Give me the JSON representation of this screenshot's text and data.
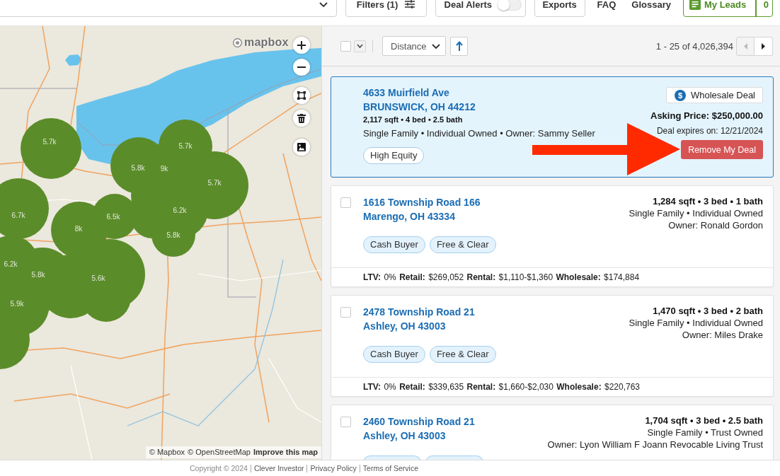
{
  "top_bar": {
    "items": [
      {
        "kind": "dropdown"
      },
      {
        "kind": "filters",
        "label": "Filters (1)"
      },
      {
        "kind": "toggle",
        "label": "Deal Alerts",
        "on": false
      },
      {
        "kind": "button",
        "label": "Exports"
      },
      {
        "kind": "link",
        "label": "FAQ"
      },
      {
        "kind": "link",
        "label": "Glossary"
      },
      {
        "kind": "leads",
        "label": "My Leads",
        "count": "0"
      }
    ]
  },
  "map": {
    "logo": "mapbox",
    "clusters": [
      {
        "label": "5.7k"
      },
      {
        "label": "6.7k"
      },
      {
        "label": "8k"
      },
      {
        "label": "6.5k"
      },
      {
        "label": "5.8k"
      },
      {
        "label": "9k"
      },
      {
        "label": "5.7k"
      },
      {
        "label": "5.7k"
      },
      {
        "label": "6.2k"
      },
      {
        "label": "5.8k"
      },
      {
        "label": "6.2k"
      },
      {
        "label": "5.8k"
      },
      {
        "label": "5.6k"
      },
      {
        "label": "5.9k"
      }
    ],
    "attribution": [
      {
        "kind": "credit",
        "label": "© Mapbox"
      },
      {
        "kind": "credit",
        "label": "© OpenStreetMap"
      },
      {
        "kind": "feedback",
        "label": "Improve this map"
      }
    ]
  },
  "list_toolbar": {
    "select_all": {
      "checked": false
    },
    "sort": {
      "value": "Distance",
      "ascending": true
    },
    "pagination": {
      "range": "1 - 25 of 4,026,394",
      "previous_disabled": true,
      "next_disabled": false
    }
  },
  "listings": [
    {
      "kind": "featured",
      "callout_arrow": true,
      "street": "4633 Muirfield Ave",
      "city": "BRUNSWICK, OH 44212",
      "facts": "2,117 sqft • 4 bed • 2.5 bath",
      "details": [
        "Single Family • Individual Owned • Owner: Sammy Seller"
      ],
      "tags": [
        {
          "kind": "outline",
          "label": "High Equity"
        }
      ],
      "badge": {
        "icon": "$",
        "label": "Wholesale Deal"
      },
      "asking_price": "Asking Price: $250,000.00",
      "expiry": "Deal expires on: 12/21/2024",
      "action": "Remove My Deal"
    },
    {
      "kind": "listing",
      "selected": false,
      "street": "1616 Township Road 166",
      "city": "Marengo, OH 43334",
      "facts": "1,284 sqft • 3 bed • 1 bath",
      "details": [
        "Single Family • Individual Owned",
        "Owner: Ronald Gordon"
      ],
      "tags": [
        {
          "kind": "filled",
          "label": "Cash Buyer"
        },
        {
          "kind": "filled",
          "label": "Free & Clear"
        }
      ],
      "metrics": "**LTV:** 0% **Retail:** $269,052 **Rental:** $1,110-$1,360 **Wholesale:** $174,884"
    },
    {
      "kind": "listing",
      "selected": false,
      "street": "2478 Township Road 21",
      "city": "Ashley, OH 43003",
      "facts": "1,470 sqft • 3 bed • 2 bath",
      "details": [
        "Single Family • Individual Owned",
        "Owner: Miles Drake"
      ],
      "tags": [
        {
          "kind": "filled",
          "label": "Cash Buyer"
        },
        {
          "kind": "filled",
          "label": "Free & Clear"
        }
      ],
      "metrics": "**LTV:** 0% **Retail:** $339,635 **Rental:** $1,660-$2,030 **Wholesale:** $220,763"
    },
    {
      "kind": "listing",
      "selected": false,
      "street": "2460 Township Road 21",
      "city": "Ashley, OH 43003",
      "facts": "1,704 sqft • 3 bed • 2.5 bath",
      "details": [
        "Single Family • Trust Owned",
        "Owner: Lyon William F Joann Revocable Living Trust"
      ],
      "tags": [
        {
          "kind": "cut-off"
        },
        {
          "kind": "cut-off"
        }
      ]
    }
  ],
  "footer": {
    "copyright": "Copyright © 2024",
    "links": [
      "Clever Investor",
      "Privacy Policy",
      "Terms of Service"
    ]
  }
}
